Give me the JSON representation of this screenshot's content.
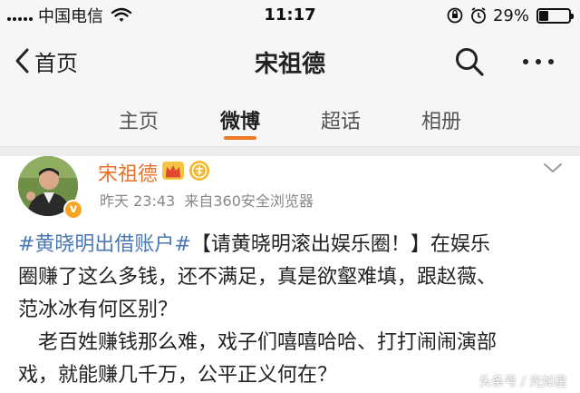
{
  "status_bar": {
    "carrier": "中国电信",
    "time": "11:17",
    "battery_percent": "29%",
    "battery_level": 0.29
  },
  "nav": {
    "back_label": "首页",
    "title": "宋祖德"
  },
  "tabs": [
    {
      "label": "主页",
      "active": false
    },
    {
      "label": "微博",
      "active": true
    },
    {
      "label": "超话",
      "active": false
    },
    {
      "label": "相册",
      "active": false
    }
  ],
  "post": {
    "author": "宋祖德",
    "time": "昨天 23:43",
    "source": "来自360安全浏览器",
    "verified_badge": "v",
    "hashtag": "#黄晓明出借账户#",
    "line1_rest": "【请黄晓明滚出娱乐圈！】在娱乐",
    "line2": "圈赚了这么多钱，还不满足，真是欲壑难填，跟赵薇、",
    "line3": "范冰冰有何区别？",
    "line4": "老百姓赚钱那么难，戏子们嘻嘻哈哈、打打闹闹演部",
    "line5": "戏，就能赚几千万，公平正义何在？"
  },
  "watermark": "头条号 / 光如星",
  "colors": {
    "accent": "#f07a25",
    "author": "#e8702a",
    "link": "#4a78b5"
  },
  "icons": [
    "signal-icon",
    "wifi-icon",
    "orientation-lock-icon",
    "alarm-icon",
    "battery-icon",
    "back-chevron-icon",
    "search-icon",
    "more-icon",
    "crown-icon",
    "medal-icon",
    "chevron-down-icon"
  ]
}
